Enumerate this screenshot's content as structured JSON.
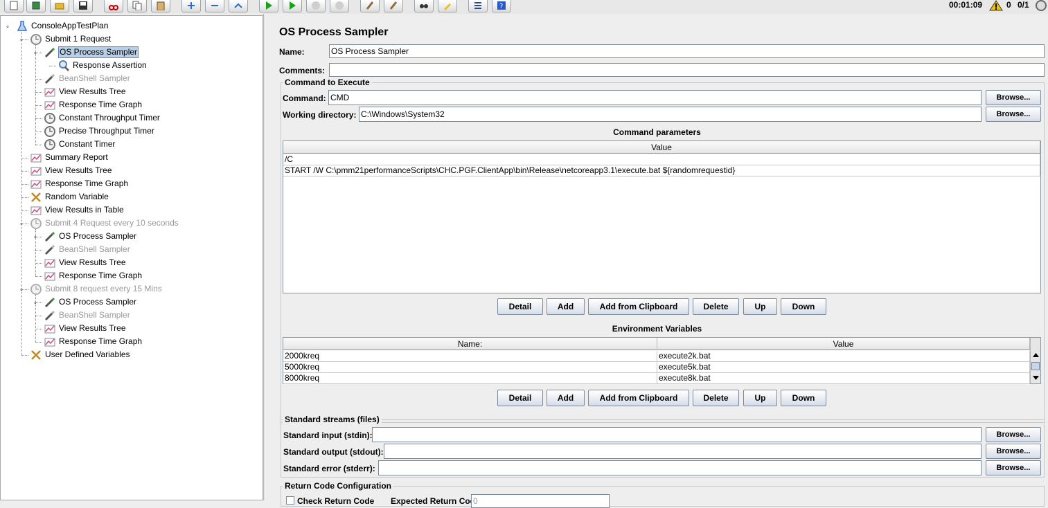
{
  "toolbar": {
    "timer": "00:01:09",
    "warning_count": "0",
    "threads": "0/1",
    "buttons": [
      "new-icon",
      "templates-icon",
      "open-icon",
      "save-icon",
      "cut-icon",
      "copy-icon",
      "paste-icon",
      "expand-icon",
      "collapse-icon",
      "toggle-icon",
      "start-icon",
      "start-no-pause-icon",
      "stop-icon",
      "shutdown-icon",
      "clear-icon",
      "clear-all-icon",
      "search-icon",
      "reset-search-icon",
      "function-helper-icon",
      "help-icon"
    ]
  },
  "tree": {
    "nodes": [
      {
        "label": "ConsoleAppTestPlan",
        "icon": "test-plan-icon"
      },
      {
        "label": "Submit 1 Request",
        "icon": "thread-group-icon"
      },
      {
        "label": "OS Process Sampler",
        "icon": "sampler-icon"
      },
      {
        "label": "Response Assertion",
        "icon": "assertion-icon"
      },
      {
        "label": "BeanShell Sampler",
        "icon": "sampler-icon"
      },
      {
        "label": "View Results Tree",
        "icon": "listener-icon"
      },
      {
        "label": "Response Time Graph",
        "icon": "listener-icon"
      },
      {
        "label": "Constant Throughput Timer",
        "icon": "timer-icon"
      },
      {
        "label": "Precise Throughput Timer",
        "icon": "timer-icon"
      },
      {
        "label": "Constant Timer",
        "icon": "timer-icon"
      },
      {
        "label": "Summary Report",
        "icon": "listener-icon"
      },
      {
        "label": "View Results Tree",
        "icon": "listener-icon"
      },
      {
        "label": "Response Time Graph",
        "icon": "listener-icon"
      },
      {
        "label": "Random Variable",
        "icon": "config-icon"
      },
      {
        "label": "View Results in Table",
        "icon": "listener-icon"
      },
      {
        "label": "Submit 4 Request every 10 seconds",
        "icon": "thread-group-icon"
      },
      {
        "label": "OS Process Sampler",
        "icon": "sampler-icon"
      },
      {
        "label": "BeanShell Sampler",
        "icon": "sampler-icon"
      },
      {
        "label": "View Results Tree",
        "icon": "listener-icon"
      },
      {
        "label": "Response Time Graph",
        "icon": "listener-icon"
      },
      {
        "label": "Submit 8 request every 15 Mins",
        "icon": "thread-group-icon"
      },
      {
        "label": "OS Process Sampler",
        "icon": "sampler-icon"
      },
      {
        "label": "BeanShell Sampler",
        "icon": "sampler-icon"
      },
      {
        "label": "View Results Tree",
        "icon": "listener-icon"
      },
      {
        "label": "Response Time Graph",
        "icon": "listener-icon"
      },
      {
        "label": "User Defined Variables",
        "icon": "config-icon"
      }
    ]
  },
  "panel": {
    "title": "OS Process Sampler",
    "name_label": "Name:",
    "name_value": "OS Process Sampler",
    "comments_label": "Comments:",
    "comments_value": "",
    "command_section": "Command to Execute",
    "command_label": "Command:",
    "command_value": "CMD",
    "workdir_label": "Working directory:",
    "workdir_value": "C:\\Windows\\System32",
    "browse": "Browse...",
    "params_title": "Command parameters",
    "params_header": "Value",
    "params_rows": [
      "/C",
      "START /W C:\\pmm21performanceScripts\\CHC.PGF.ClientApp\\bin\\Release\\netcoreapp3.1\\execute.bat ${randomrequestid}"
    ],
    "buttons": {
      "detail": "Detail",
      "add": "Add",
      "clipboard": "Add from Clipboard",
      "delete": "Delete",
      "up": "Up",
      "down": "Down"
    },
    "env_title": "Environment Variables",
    "env_header_name": "Name:",
    "env_header_value": "Value",
    "env_rows": [
      {
        "name": "2000kreq",
        "value": "execute2k.bat"
      },
      {
        "name": "5000kreq",
        "value": "execute5k.bat"
      },
      {
        "name": "8000kreq",
        "value": "execute8k.bat"
      }
    ],
    "streams_section": "Standard streams (files)",
    "stdin_label": "Standard input (stdin):",
    "stdout_label": "Standard output (stdout):",
    "stderr_label": "Standard error (stderr):",
    "return_section": "Return Code Configuration",
    "check_return_label": "Check Return Code",
    "expected_return_label": "Expected Return Code:",
    "expected_return_value": "0"
  }
}
